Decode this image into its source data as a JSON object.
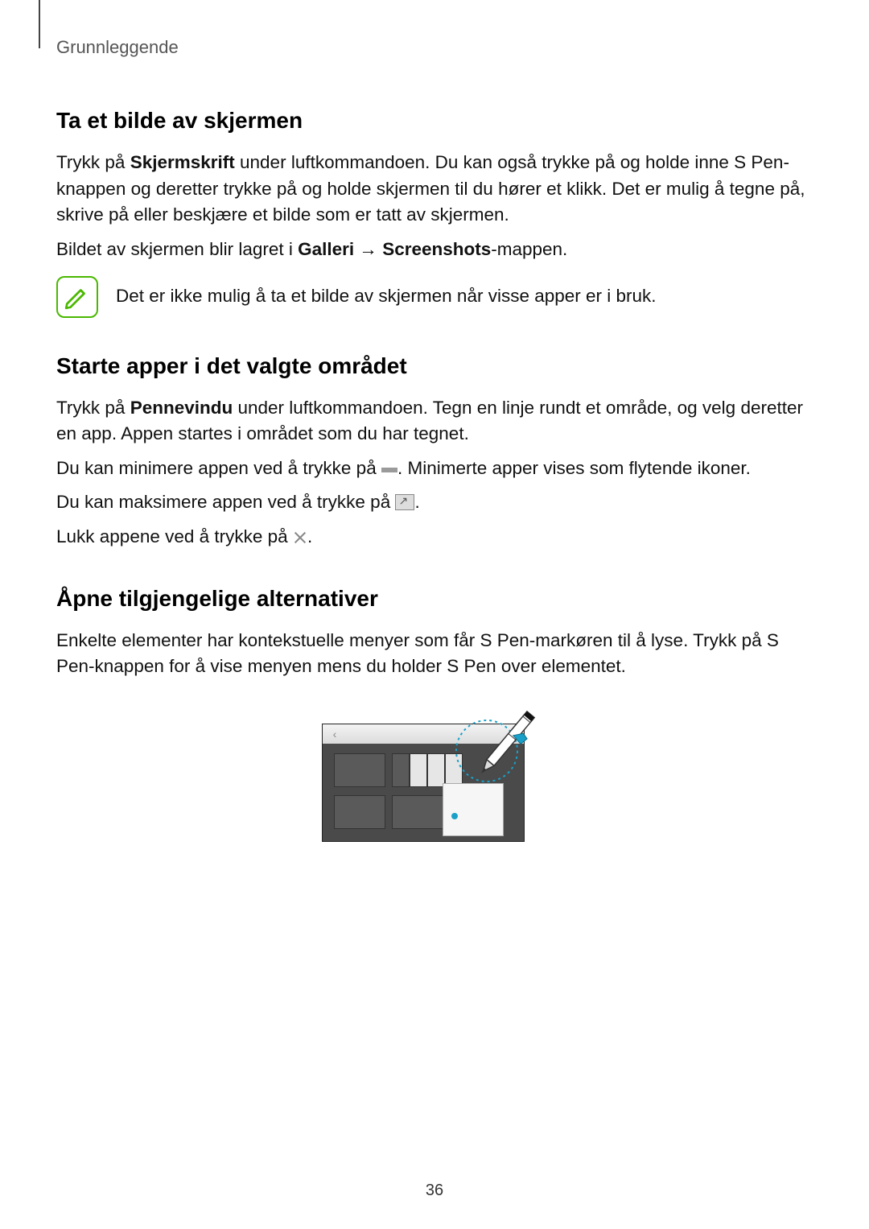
{
  "breadcrumb": "Grunnleggende",
  "section1": {
    "heading": "Ta et bilde av skjermen",
    "p1_a": "Trykk på ",
    "p1_b_bold": "Skjermskrift",
    "p1_c": " under luftkommandoen. Du kan også trykke på og holde inne S Pen-knappen og deretter trykke på og holde skjermen til du hører et klikk. Det er mulig å tegne på, skrive på eller beskjære et bilde som er tatt av skjermen.",
    "p2_a": "Bildet av skjermen blir lagret i ",
    "p2_b_bold": "Galleri",
    "p2_arrow": " → ",
    "p2_c_bold": "Screenshots",
    "p2_d": "-mappen.",
    "note": "Det er ikke mulig å ta et bilde av skjermen når visse apper er i bruk."
  },
  "section2": {
    "heading": "Starte apper i det valgte området",
    "p1_a": "Trykk på ",
    "p1_b_bold": "Pennevindu",
    "p1_c": " under luftkommandoen. Tegn en linje rundt et område, og velg deretter en app. Appen startes i området som du har tegnet.",
    "p2_a": "Du kan minimere appen ved å trykke på ",
    "p2_b": ". Minimerte apper vises som flytende ikoner.",
    "p3": "Du kan maksimere appen ved å trykke på ",
    "p3_end": ".",
    "p4": "Lukk appene ved å trykke på ",
    "p4_end": "."
  },
  "section3": {
    "heading": "Åpne tilgjengelige alternativer",
    "p1": "Enkelte elementer har kontekstuelle menyer som får S Pen-markøren til å lyse. Trykk på S Pen-knappen for å vise menyen mens du holder S Pen over elementet."
  },
  "page_number": "36"
}
